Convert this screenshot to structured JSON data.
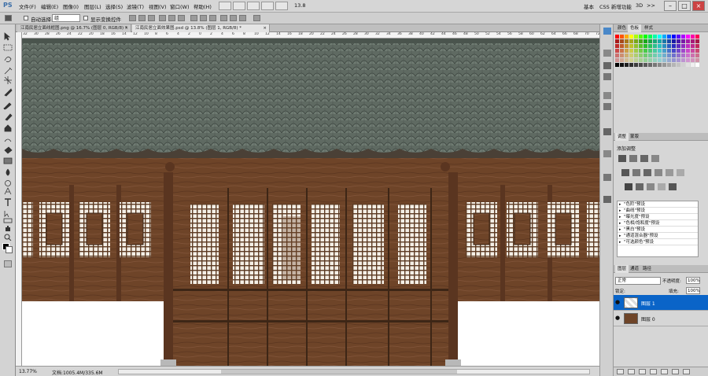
{
  "menubar": {
    "logo": "PS",
    "items": [
      "文件(F)",
      "编辑(E)",
      "图像(I)",
      "图层(L)",
      "选择(S)",
      "滤镜(T)",
      "视图(V)",
      "窗口(W)",
      "帮助(H)"
    ],
    "zoom": "13.8",
    "workspace": [
      "基本",
      "CSS 新增功能"
    ],
    "workspace_3d": "3D",
    "more": ">>"
  },
  "options": {
    "auto_select": "自动选择:",
    "auto_select_value": "组",
    "show_transform": "显示变换控件"
  },
  "tabs": [
    {
      "title": "江南民居立面线框图.png @ 16.7% (图层 0, RGB/8) *",
      "active": false
    },
    {
      "title": "江南民居立面效果图.psd @ 13.8% (图层 1, RGB/8) *",
      "active": true
    }
  ],
  "ruler": {
    "top": [
      "32",
      "30",
      "28",
      "26",
      "24",
      "22",
      "20",
      "18",
      "16",
      "14",
      "12",
      "10",
      "8",
      "6",
      "4",
      "2",
      "0",
      "2",
      "4",
      "6",
      "8",
      "10",
      "12",
      "14",
      "16",
      "18",
      "20",
      "22",
      "24",
      "26",
      "28",
      "30",
      "32",
      "34",
      "36",
      "38",
      "40",
      "42",
      "44",
      "46",
      "48",
      "50",
      "52",
      "54",
      "56",
      "58",
      "60",
      "62",
      "64",
      "66",
      "68",
      "70",
      "72"
    ]
  },
  "status": {
    "zoom": "13.77%",
    "doc": "文档:1005.4M/335.6M"
  },
  "panels": {
    "color_tabs": [
      "颜色",
      "色板",
      "样式"
    ],
    "adjustments_tabs": [
      "调整",
      "蒙版"
    ],
    "adjustments_title": "添加调整",
    "presets": [
      "\"色阶\"预设",
      "\"曲线\"预设",
      "\"曝光度\"预设",
      "\"色相/饱和度\"预设",
      "\"黑白\"预设",
      "\"通道混合器\"预设",
      "\"可选颜色\"预设"
    ],
    "layers_tabs": [
      "图层",
      "通道",
      "路径"
    ],
    "blend_mode": "正常",
    "opacity_label": "不透明度:",
    "opacity_value": "100%",
    "lock_label": "锁定:",
    "fill_label": "填充:",
    "fill_value": "100%",
    "layers": [
      {
        "name": "图层 1",
        "selected": true
      },
      {
        "name": "图层 0",
        "selected": false
      }
    ]
  },
  "colors": {
    "wood": "#6e4428",
    "roof": "#5e6a60",
    "selected_layer": "#0a64c8"
  }
}
